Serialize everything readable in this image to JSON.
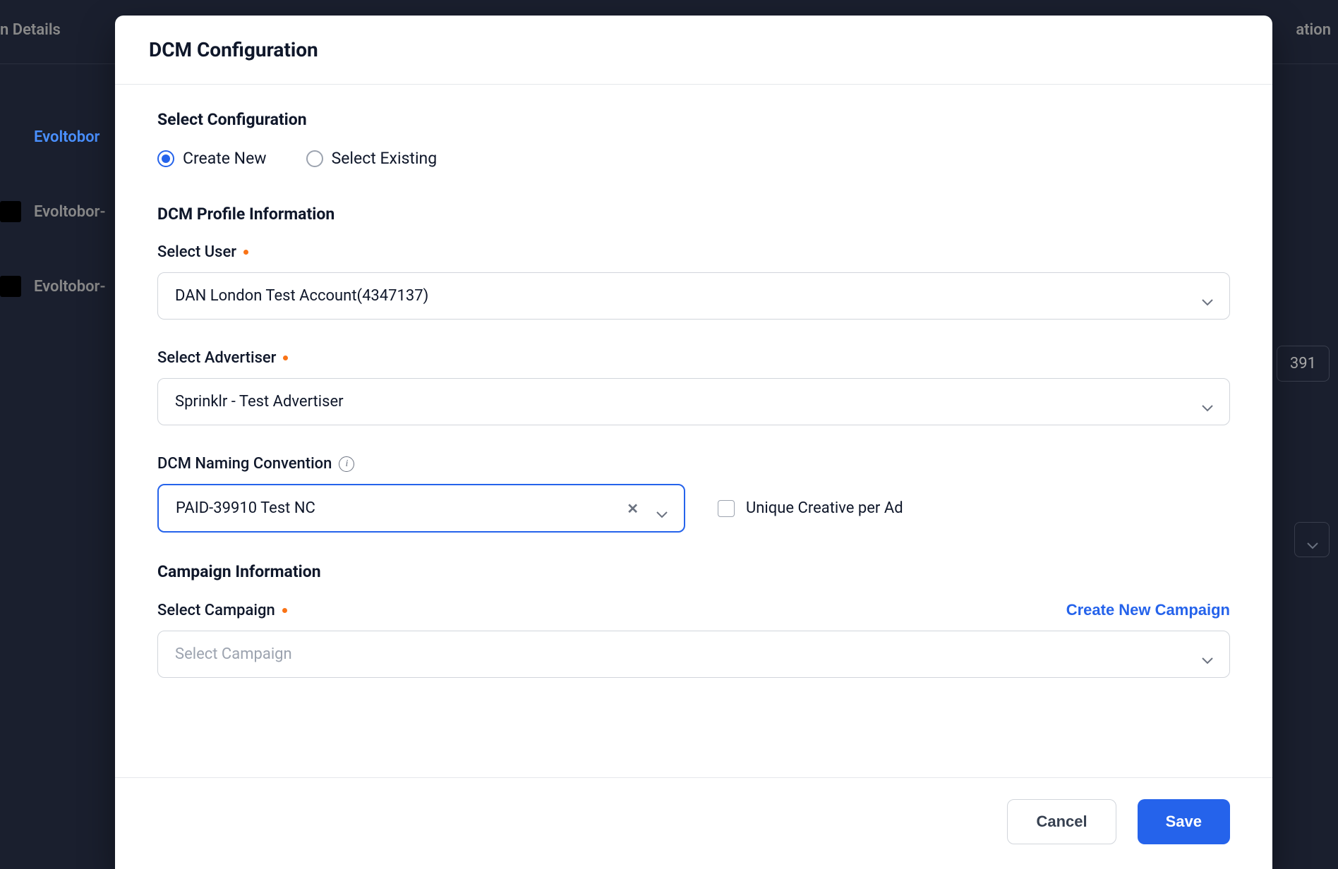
{
  "background": {
    "header_left": "n Details",
    "header_right": "ation",
    "item1": "Evoltobor",
    "item2": "Evoltobor-",
    "item3": "Evoltobor-",
    "tag": "391"
  },
  "modal": {
    "title": "DCM Configuration",
    "select_config_heading": "Select Configuration",
    "radio_create_new": "Create New",
    "radio_select_existing": "Select Existing",
    "dcm_profile_heading": "DCM Profile Information",
    "select_user_label": "Select User",
    "select_user_value": "DAN London Test Account(4347137)",
    "select_advertiser_label": "Select Advertiser",
    "select_advertiser_value": "Sprinklr - Test Advertiser",
    "naming_convention_label": "DCM Naming Convention",
    "naming_convention_value": "PAID-39910 Test NC",
    "unique_creative_label": "Unique Creative per Ad",
    "campaign_info_heading": "Campaign Information",
    "select_campaign_label": "Select Campaign",
    "create_new_campaign": "Create New Campaign",
    "select_campaign_placeholder": "Select Campaign",
    "cancel": "Cancel",
    "save": "Save"
  }
}
